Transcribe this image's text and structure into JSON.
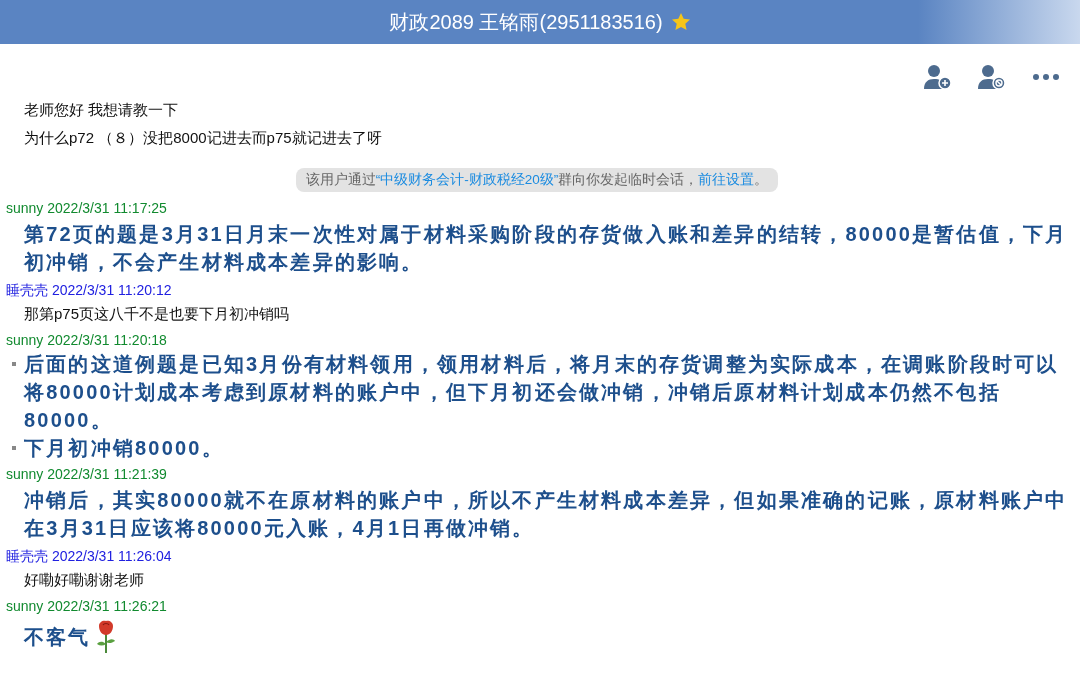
{
  "window": {
    "title": "财政2089 王铭雨(2951183516)"
  },
  "toolbar": [
    {
      "kind": "add-member"
    },
    {
      "kind": "block"
    },
    {
      "kind": "more"
    }
  ],
  "intro": {
    "lines": [
      "老师您好 我想请教一下",
      "为什么p72 （８）没把8000记进去而p75就记进去了呀"
    ]
  },
  "notice": {
    "prefix": "该用户通过",
    "group": "“中级财务会计-财政税经20级”",
    "middle": "群向你发起临时会话，",
    "link": "前往设置",
    "suffix": "。"
  },
  "messages": [
    {
      "sender": "sunny",
      "time": "2022/3/31 11:17:25",
      "color": "#118a2f",
      "kind": "bold",
      "paragraphs": [
        "第72页的题是3月31日月末一次性对属于材料采购阶段的存货做入账和差异的结转，80000是暂估值，下月初冲销，不会产生材料成本差异的影响。"
      ]
    },
    {
      "sender": "睡壳壳",
      "time": "2022/3/31 11:20:12",
      "color": "#2020e0",
      "kind": "plain",
      "paragraphs": [
        "那第p75页这八千不是也要下月初冲销吗"
      ]
    },
    {
      "sender": "sunny",
      "time": "2022/3/31 11:20:18",
      "color": "#118a2f",
      "kind": "bullets",
      "paragraphs": [
        "后面的这道例题是已知3月份有材料领用，领用材料后，将月末的存货调整为实际成本，在调账阶段时可以将80000计划成本考虑到原材料的账户中，但下月初还会做冲销，冲销后原材料计划成本仍然不包括80000。",
        "下月初冲销80000。"
      ]
    },
    {
      "sender": "sunny",
      "time": "2022/3/31 11:21:39",
      "color": "#118a2f",
      "kind": "bold",
      "paragraphs": [
        "冲销后，其实80000就不在原材料的账户中，所以不产生材料成本差异，但如果准确的记账，原材料账户中在3月31日应该将80000元入账，4月1日再做冲销。"
      ]
    },
    {
      "sender": "睡壳壳",
      "time": "2022/3/31 11:26:04",
      "color": "#2020e0",
      "kind": "plain",
      "paragraphs": [
        "好嘞好嘞谢谢老师"
      ]
    },
    {
      "sender": "sunny",
      "time": "2022/3/31 11:26:21",
      "color": "#118a2f",
      "kind": "rose",
      "paragraphs": [
        "不客气"
      ]
    }
  ]
}
